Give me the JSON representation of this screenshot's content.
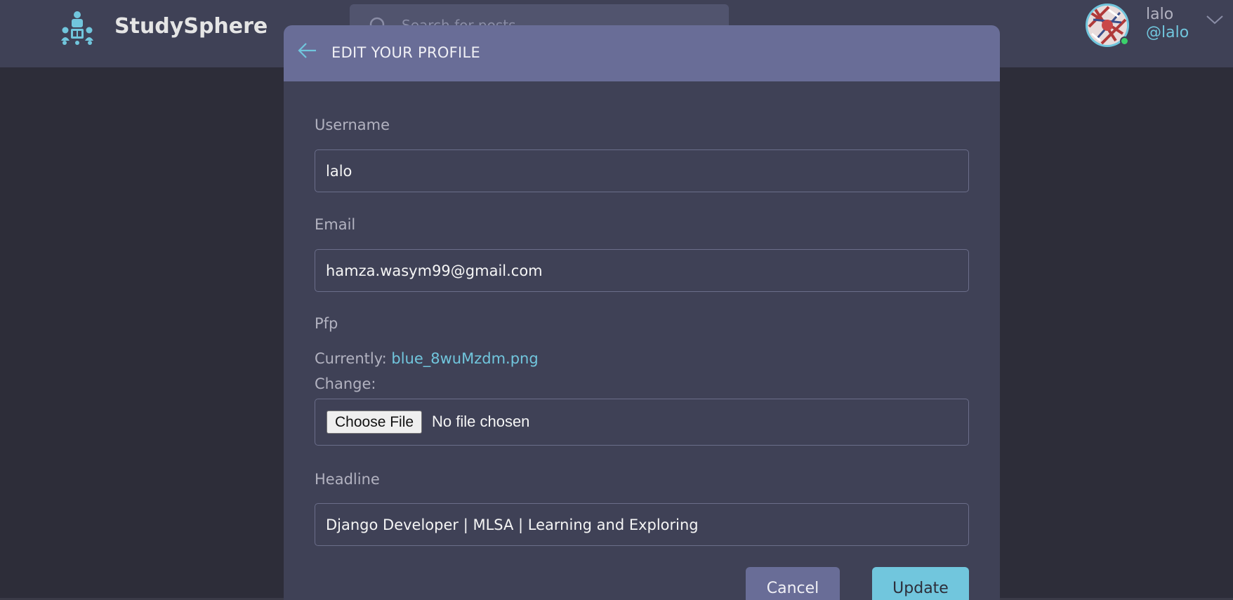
{
  "app": {
    "brand": "StudySphere"
  },
  "search": {
    "placeholder": "Search for posts..."
  },
  "user": {
    "name": "lalo",
    "handle": "@lalo"
  },
  "modal": {
    "title": "EDIT YOUR PROFILE",
    "fields": {
      "username": {
        "label": "Username",
        "value": "lalo"
      },
      "email": {
        "label": "Email",
        "value": "hamza.wasym99@gmail.com"
      },
      "pfp": {
        "label": "Pfp",
        "currently_label": "Currently:",
        "current_file": "blue_8wuMzdm.png",
        "change_label": "Change:",
        "choose_button": "Choose File",
        "no_file_text": "No file chosen"
      },
      "headline": {
        "label": "Headline",
        "value": "Django Developer | MLSA | Learning and Exploring"
      }
    },
    "actions": {
      "cancel": "Cancel",
      "update": "Update"
    }
  },
  "colors": {
    "background": "#2d2d39",
    "surface": "#3f4156",
    "modal_header": "#696d97",
    "accent": "#71c6dd",
    "online": "#3bd16b"
  }
}
